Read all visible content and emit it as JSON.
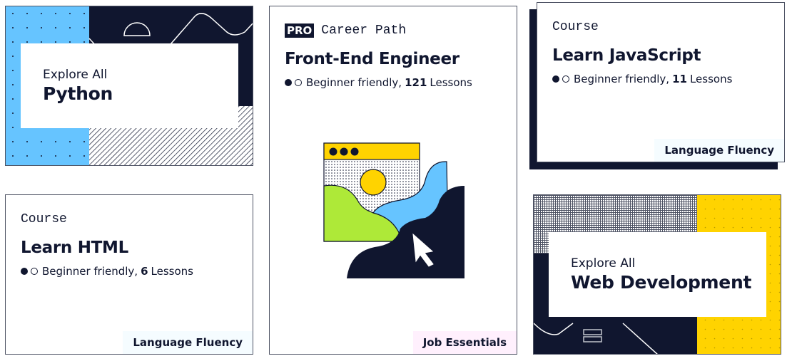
{
  "cards": {
    "python": {
      "subtitle": "Explore All",
      "title": "Python"
    },
    "frontend": {
      "badge": "PRO",
      "type": "Career Path",
      "title": "Front-End Engineer",
      "difficulty": "Beginner friendly,",
      "lesson_count": "121",
      "lesson_label": "Lessons",
      "tag": "Job Essentials",
      "illustration": "browser-window-cursor-illustration"
    },
    "javascript": {
      "type": "Course",
      "title": "Learn JavaScript",
      "difficulty": "Beginner friendly,",
      "lesson_count": "11",
      "lesson_label": "Lessons",
      "tag": "Language Fluency"
    },
    "html": {
      "type": "Course",
      "title": "Learn HTML",
      "difficulty": "Beginner friendly,",
      "lesson_count": "6",
      "lesson_label": "Lessons",
      "tag": "Language Fluency"
    },
    "webdev": {
      "subtitle": "Explore All",
      "title": "Web Development"
    }
  },
  "colors": {
    "navy": "#10162f",
    "blue": "#66c4ff",
    "yellow": "#ffd300",
    "green": "#aee938",
    "lang_tag_bg": "#f5fcff",
    "job_tag_bg": "#fff0fd"
  }
}
